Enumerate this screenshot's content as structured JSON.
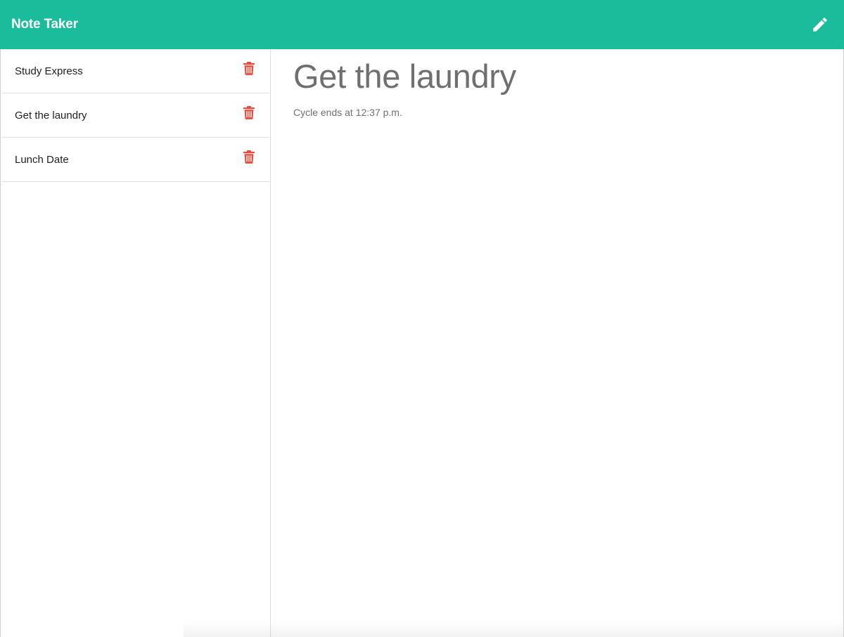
{
  "navbar": {
    "title": "Note Taker",
    "bg_color": "#1abc9c",
    "edit_icon": "pencil-icon"
  },
  "sidebar": {
    "notes": [
      {
        "title": "Study Express",
        "delete_icon": "trash-icon"
      },
      {
        "title": "Get the laundry",
        "delete_icon": "trash-icon"
      },
      {
        "title": "Lunch Date",
        "delete_icon": "trash-icon"
      }
    ],
    "delete_color": "#e74c3c"
  },
  "main": {
    "note_title": "Get the laundry",
    "note_text": "Cycle ends at 12:37 p.m."
  }
}
